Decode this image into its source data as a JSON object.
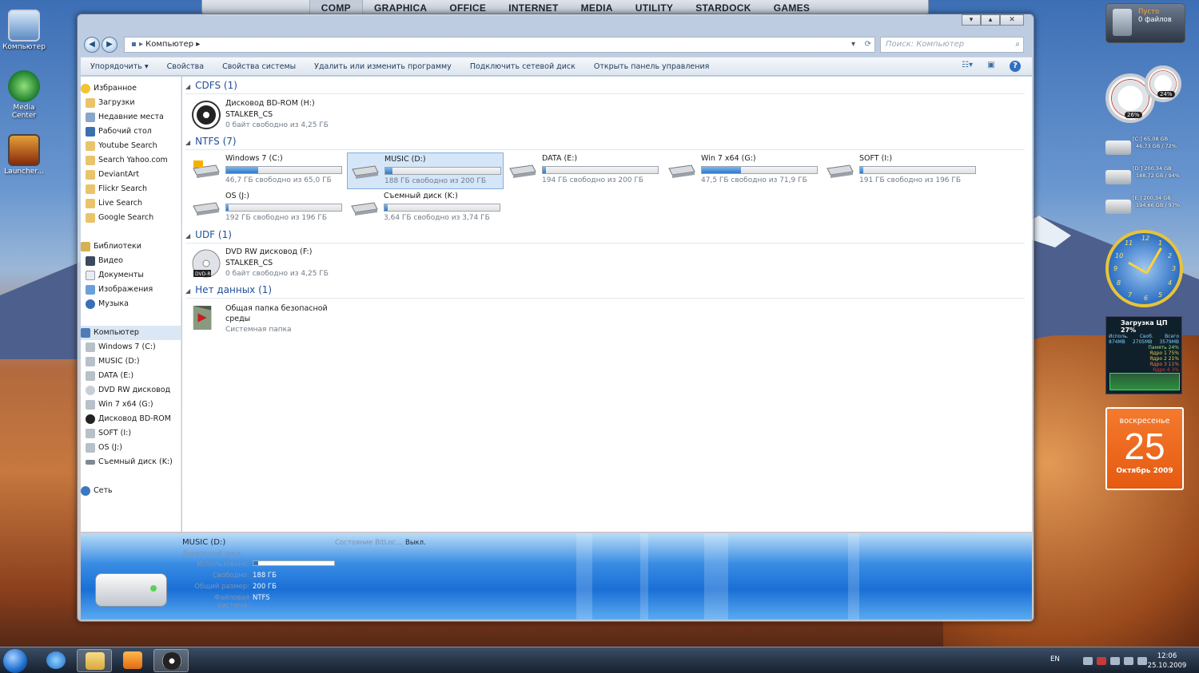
{
  "dock": {
    "items": [
      "COMP",
      "GRAPHICA",
      "OFFICE",
      "INTERNET",
      "MEDIA",
      "UTILITY",
      "STARDOCK",
      "GAMES"
    ]
  },
  "desktop": {
    "icons": [
      "Компьютер",
      "Media Center",
      "Launcher..."
    ]
  },
  "window": {
    "caption_buttons": [
      "▾",
      "▴",
      "✕"
    ],
    "address": "Компьютер",
    "search_placeholder": "Поиск: Компьютер",
    "toolbar": [
      "Упорядочить ▾",
      "Свойства",
      "Свойства системы",
      "Удалить или изменить программу",
      "Подключить сетевой диск",
      "Открыть панель управления"
    ]
  },
  "sidebar": {
    "favorites_head": "Избранное",
    "favorites": [
      "Загрузки",
      "Недавние места",
      "Рабочий стол",
      "Youtube Search",
      "Search Yahoo.com",
      "DeviantArt",
      "Flickr Search",
      "Live Search",
      "Google Search"
    ],
    "libraries_head": "Библиотеки",
    "libraries": [
      "Видео",
      "Документы",
      "Изображения",
      "Музыка"
    ],
    "computer_head": "Компьютер",
    "computer": [
      "Windows 7 (C:)",
      "MUSIC (D:)",
      "DATA (E:)",
      "DVD RW дисковод",
      "Win 7 x64 (G:)",
      "Дисковод BD-ROM",
      "SOFT (I:)",
      "OS (J:)",
      "Съемный диск (K:)"
    ],
    "network_head": "Сеть"
  },
  "groups": {
    "cdfs": "CDFS (1)",
    "ntfs": "NTFS (7)",
    "udf": "UDF (1)",
    "nodata": "Нет данных (1)"
  },
  "drives": {
    "bd": {
      "name": "Дисковод BD-ROM (H:)",
      "label": "STALKER_CS",
      "free": "0 байт свободно из 4,25 ГБ"
    },
    "c": {
      "name": "Windows 7 (C:)",
      "free": "46,7 ГБ свободно из 65,0 ГБ",
      "used_fraction": 0.28
    },
    "d": {
      "name": "MUSIC (D:)",
      "free": "188 ГБ свободно из 200 ГБ",
      "used_fraction": 0.06
    },
    "e": {
      "name": "DATA (E:)",
      "free": "194 ГБ свободно из 200 ГБ",
      "used_fraction": 0.03
    },
    "g": {
      "name": "Win 7 x64 (G:)",
      "free": "47,5 ГБ свободно из 71,9 ГБ",
      "used_fraction": 0.34
    },
    "i": {
      "name": "SOFT (I:)",
      "free": "191 ГБ свободно из 196 ГБ",
      "used_fraction": 0.03
    },
    "j": {
      "name": "OS (J:)",
      "free": "192 ГБ свободно из 196 ГБ",
      "used_fraction": 0.02
    },
    "k": {
      "name": "Съемный диск (K:)",
      "free": "3,64 ГБ свободно из 3,74 ГБ",
      "used_fraction": 0.03
    },
    "f": {
      "name": "DVD RW дисковод (F:)",
      "label": "STALKER_CS",
      "free": "0 байт свободно из 4,25 ГБ",
      "badge": "DVD-R"
    },
    "share": {
      "name": "Общая папка безопасной среды",
      "type": "Системная папка"
    }
  },
  "details": {
    "title": "MUSIC (D:)",
    "subtitle": "Локальный диск",
    "used_label": "Использовано:",
    "used_fraction": 0.06,
    "free_label": "Свободно:",
    "free_value": "188 ГБ",
    "total_label": "Общий размер:",
    "total_value": "200 ГБ",
    "fs_label": "Файловая система:",
    "fs_value": "NTFS",
    "bitlocker_label": "Состояние BitLoc...",
    "bitlocker_value": "Выкл."
  },
  "gadgets": {
    "bin_status": "Пусто",
    "bin_files": "0 файлов",
    "gauge_cpu": "26%",
    "gauge_mem": "24%",
    "drives": [
      {
        "l1": "[C:] 65.08 GB",
        "l2": "46.73 GB / 72%"
      },
      {
        "l1": "[D:] 200.34 GB",
        "l2": "188.72 GB / 94%"
      },
      {
        "l1": "[E:] 200.34 GB",
        "l2": "194.66 GB / 97%"
      }
    ],
    "clock_numbers": [
      "12",
      "1",
      "2",
      "3",
      "4",
      "5",
      "6",
      "7",
      "8",
      "9",
      "10",
      "11"
    ],
    "cpu": {
      "head": "Загрузка ЦП 27%",
      "col1": "Исполь.",
      "col2": "Своб.",
      "col3": "Всего",
      "val1": "874MB",
      "val2": "2705MB",
      "val3": "3579MB",
      "rows": [
        "Память 24%",
        "Ядро 1 75%",
        "Ядро 2 21%",
        "Ядро 3 11%",
        "Ядро 4 3%"
      ]
    },
    "calendar": {
      "dow": "воскресенье",
      "day": "25",
      "month": "Октябрь 2009"
    }
  },
  "taskbar": {
    "lang": "EN",
    "time": "12:06",
    "date": "25.10.2009"
  }
}
